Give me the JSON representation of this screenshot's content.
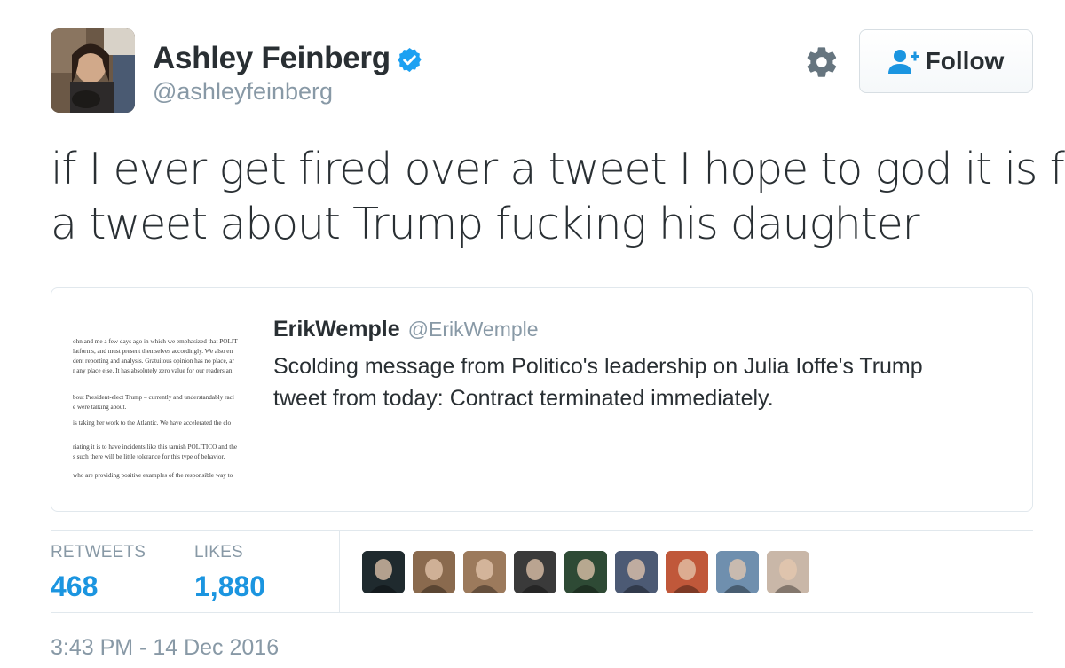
{
  "author": {
    "name": "Ashley Feinberg",
    "handle": "@ashleyfeinberg",
    "verified": true
  },
  "actions": {
    "follow_label": "Follow"
  },
  "tweet": {
    "text_lines": [
      "if I ever get fired over a tweet I hope to god it is for",
      "a tweet about Trump fucking his daughter"
    ]
  },
  "quoted_tweet": {
    "name": "ErikWemple",
    "handle": "@ErikWemple",
    "text_lines": [
      "Scolding message from Politico's leadership on Julia Ioffe's Trump",
      "tweet from today: Contract terminated immediately."
    ],
    "media_lines": [
      "ohn and me a few days ago in which we emphasized that POLIT",
      "latforms, and must present themselves accordingly. We also en",
      "dent reporting and analysis. Gratuitous opinion has no place, ar",
      "r any place else. It has absolutely zero value for our readers an",
      "bout President-elect Trump – currently and understandably racl",
      "e were talking about.",
      "is taking her work to the Atlantic. We have accelerated the clo",
      "riating it is to have incidents like this tarnish POLITICO and the",
      "s such there will be little tolerance for this type of behavior.",
      "who are providing positive examples of the responsible way to"
    ]
  },
  "stats": {
    "retweets_label": "RETWEETS",
    "retweets_count": "468",
    "likes_label": "LIKES",
    "likes_count": "1,880"
  },
  "likers": [
    "#1f2a2e",
    "#8a6a4e",
    "#9c7a5c",
    "#3a3a3a",
    "#2e4a35",
    "#4c5a74",
    "#c0583a",
    "#6f8fae",
    "#c9b7a8"
  ],
  "timestamp": "3:43 PM - 14 Dec 2016",
  "colors": {
    "link_blue": "#1b95e0",
    "muted_gray": "#8899a6",
    "border": "#e1e8ed",
    "verified_blue": "#1da1f2"
  }
}
